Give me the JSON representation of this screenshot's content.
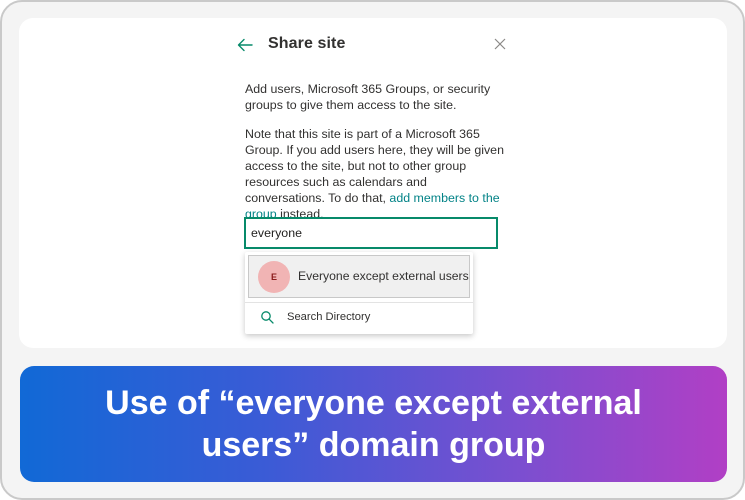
{
  "panel": {
    "title": "Share site",
    "paragraph1": "Add users, Microsoft 365 Groups, or security groups to give them access to the site.",
    "paragraph2_prefix": "Note that this site is part of a Microsoft 365 Group. If you add users here, they will be given access to the site, but not to other group resources such as calendars and conversations. To do that, ",
    "paragraph2_link": "add members to the group",
    "paragraph2_suffix": " instead."
  },
  "search": {
    "value": "everyone"
  },
  "dropdown": {
    "suggestion": {
      "avatar_initial": "E",
      "label": "Everyone except external users"
    },
    "search_directory_label": "Search Directory"
  },
  "banner": {
    "text": "Use of “everyone except external users” domain group"
  },
  "colors": {
    "accent": "#078a6a",
    "link": "#038387",
    "avatar_bg": "#f1b4b4"
  },
  "icons": [
    "back-arrow-icon",
    "close-icon",
    "search-icon"
  ]
}
